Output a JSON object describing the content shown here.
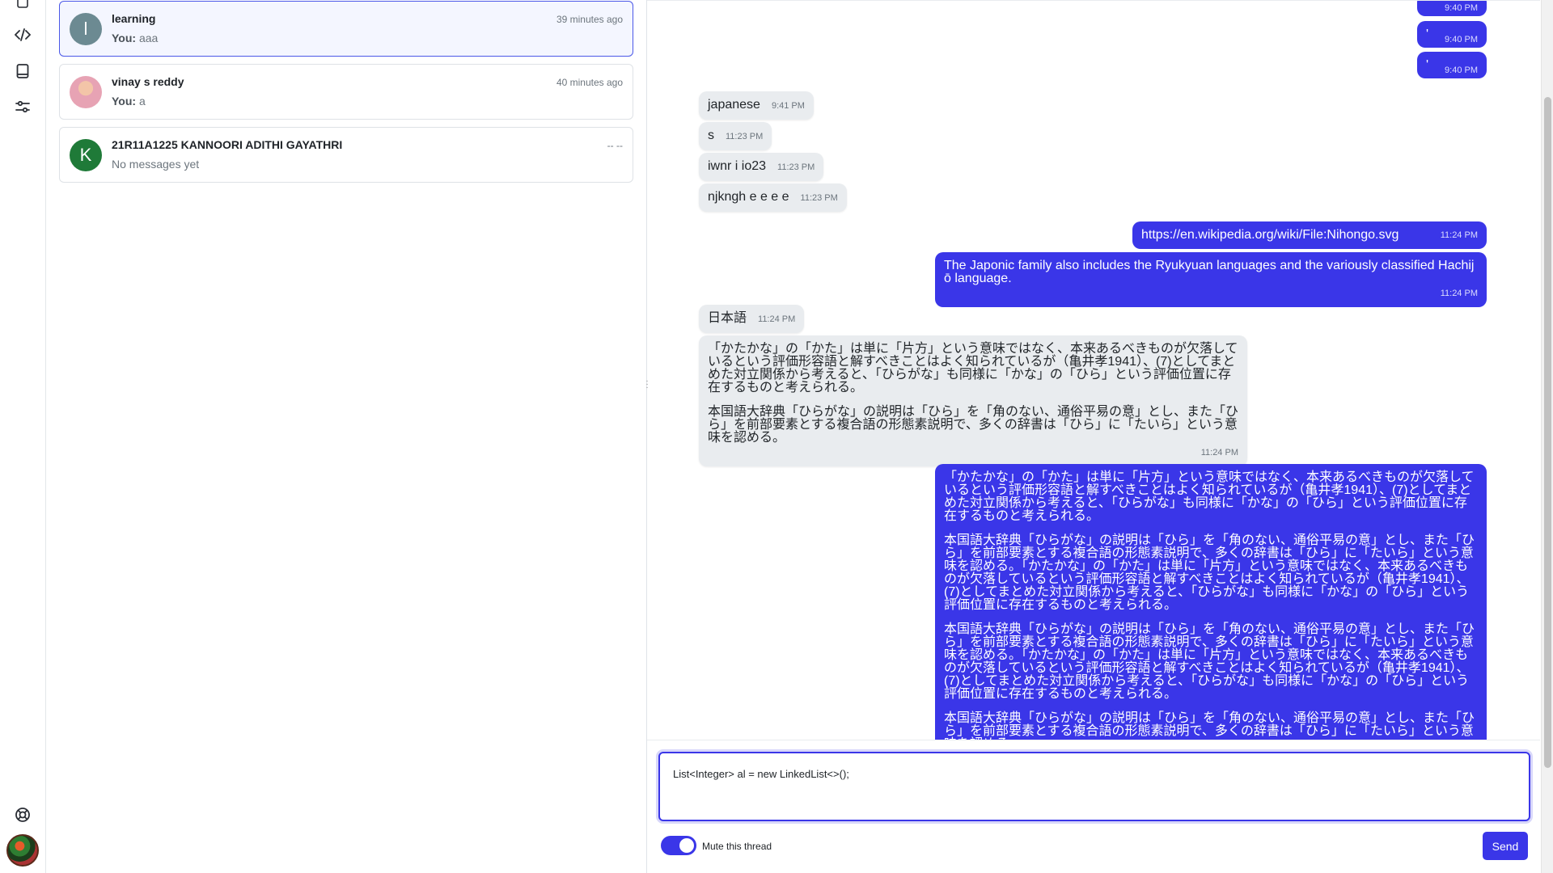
{
  "rail": {
    "icons": [
      "home-icon",
      "code-icon",
      "book-icon",
      "sliders-icon",
      "help-icon"
    ]
  },
  "threads": [
    {
      "initial": "l",
      "name": "learning",
      "time": "39 minutes ago",
      "preview_prefix": "You:",
      "preview": "aaa",
      "avatar_color": "#6c8a92",
      "active": true
    },
    {
      "initial": "",
      "name": "vinay s reddy",
      "time": "40 minutes ago",
      "preview_prefix": "You:",
      "preview": "a",
      "avatar_color": "#e7a3b4",
      "active": false
    },
    {
      "initial": "K",
      "name": "21R11A1225 KANNOORI ADITHI GAYATHRI",
      "time": "-- --",
      "preview_prefix": "",
      "preview": "No messages yet",
      "avatar_color": "#1f7a38",
      "active": false
    }
  ],
  "messages": {
    "m0": {
      "text": "",
      "time": "9:40 PM"
    },
    "m1": {
      "text": "'",
      "time": "9:40 PM"
    },
    "m2": {
      "text": "'",
      "time": "9:40 PM"
    },
    "m3": {
      "text": "japanese",
      "time": "9:41 PM"
    },
    "m4": {
      "text": "s",
      "time": "11:23 PM"
    },
    "m5": {
      "text": "iwnr i io23",
      "time": "11:23 PM"
    },
    "m6": {
      "text": "njkngh e e e e",
      "time": "11:23 PM"
    },
    "m7": {
      "text": "https://en.wikipedia.org/wiki/File:Nihongo.svg",
      "time": "11:24 PM"
    },
    "m8": {
      "text": "The Japonic family also includes the Ryukyuan languages and the variously classified Hachijō language.",
      "time": "11:24 PM"
    },
    "m9": {
      "text": "日本語",
      "time": "11:24 PM"
    },
    "m10": {
      "p1": "「かたかな」の「かた」は単に「片方」という意味ではなく、本来あるべきものが欠落しているという評価形容語と解すべきことはよく知られているが（亀井孝1941）、(7)としてまとめた対立関係から考えると、「ひらがな」も同様に「かな」の「ひら」という評価位置に存在するものと考えられる。",
      "p2": "本国語大辞典「ひらがな」の説明は「ひら」を「角のない、通俗平易の意」とし、また「ひら」を前部要素とする複合語の形態素説明で、多くの辞書は「ひら」に「たいら」という意味を認める。",
      "time": "11:24 PM"
    },
    "m11": {
      "p1": "「かたかな」の「かた」は単に「片方」という意味ではなく、本来あるべきものが欠落しているという評価形容語と解すべきことはよく知られているが（亀井孝1941）、(7)としてまとめた対立関係から考えると、「ひらがな」も同様に「かな」の「ひら」という評価位置に存在するものと考えられる。",
      "p2": "本国語大辞典「ひらがな」の説明は「ひら」を「角のない、通俗平易の意」とし、また「ひら」を前部要素とする複合語の形態素説明で、多くの辞書は「ひら」に「たいら」という意味を認める。「かたかな」の「かた」は単に「片方」という意味ではなく、本来あるべきものが欠落しているという評価形容語と解すべきことはよく知られているが（亀井孝1941）、(7)としてまとめた対立関係から考えると、「ひらがな」も同様に「かな」の「ひら」という評価位置に存在するものと考えられる。",
      "p3": "本国語大辞典「ひらがな」の説明は「ひら」を「角のない、通俗平易の意」とし、また「ひら」を前部要素とする複合語の形態素説明で、多くの辞書は「ひら」に「たいら」という意味を認める。「かたかな」の「かた」は単に「片方」という意味ではなく、本来あるべきものが欠落しているという評価形容語と解すべきことはよく知られているが（亀井孝1941）、(7)としてまとめた対立関係から考えると、「ひらがな」も同様に「かな」の「ひら」という評価位置に存在するものと考えられる。",
      "p4": "本国語大辞典「ひらがな」の説明は「ひら」を「角のない、通俗平易の意」とし、また「ひら」を前部要素とする複合語の形態素説明で、多くの辞書は「ひら」に「たいら」という意味を認める。"
    }
  },
  "composer": {
    "value": "List<Integer> al = new LinkedList<>();",
    "mute_label": "Mute this thread",
    "mute_on": true,
    "send_label": "Send"
  },
  "colors": {
    "accent": "#3a36e8",
    "incoming_bubble": "#e9ecef"
  }
}
